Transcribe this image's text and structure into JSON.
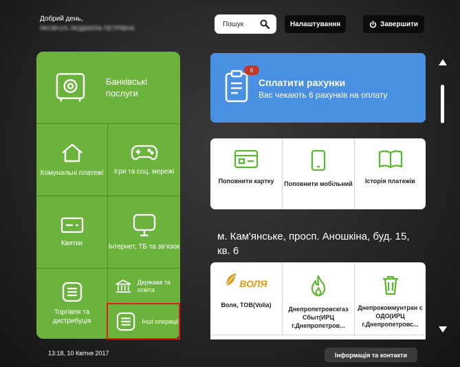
{
  "header": {
    "greeting": "Добрий день,",
    "user_name": "ЯКОВЧУК ЛЮДМИЛА ПЕТРІВНА",
    "search_label": "Пошук",
    "settings_label": "Налаштування",
    "exit_label": "Завершити"
  },
  "tiles": {
    "bank": "Банківські послуги",
    "communal": "Комунальні платежі",
    "games": "Ігри та соц. мережі",
    "tickets": "Квитки",
    "internet": "Інтернет, ТБ та зв'язок",
    "trade": "Торгівля та дистрибуція",
    "gov": "Держава та освіта",
    "other": "Інші операції"
  },
  "pay_bills": {
    "title": "Сплатити рахунки",
    "subtitle": "Вас чекають 6 рахунків на оплату",
    "badge": "6"
  },
  "quick_actions": [
    {
      "label": "Поповнити картку",
      "icon": "card-icon"
    },
    {
      "label": "Поповнити мобільний",
      "icon": "mobile-icon"
    },
    {
      "label": "Історія платежів",
      "icon": "book-icon"
    }
  ],
  "address": "м. Кам'янське, просп. Аношкіна, буд. 15, кв. 6",
  "providers": [
    {
      "logo": "ВОЛЯ",
      "label": "Воля, ТОВ(Volia)"
    },
    {
      "label": "Днепропетровскгаз Сбыт(ИРЦ г.Днепропетров..."
    },
    {
      "label": "Днепрокоммунтран с ОДО(ИРЦ г.Днепропетровс..."
    }
  ],
  "footer": {
    "datetime": "13:18,  10 Квітня 2017",
    "info_label": "Інформація та контакти"
  },
  "colors": {
    "green_tile": "#6bb33d",
    "blue_card": "#4a90e2",
    "highlight": "#e21d1d",
    "icon_green": "#5cb531"
  }
}
